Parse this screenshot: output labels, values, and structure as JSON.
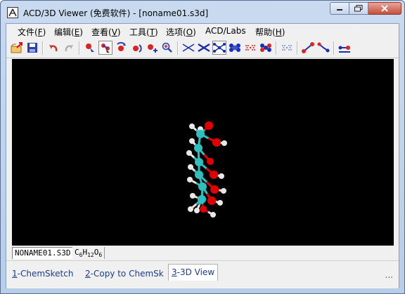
{
  "window": {
    "title": "ACD/3D Viewer (免费软件) - [noname01.s3d]"
  },
  "menu": {
    "items": [
      {
        "label": "文件(",
        "key": "F",
        "end": ")"
      },
      {
        "label": "编辑(",
        "key": "E",
        "end": ")"
      },
      {
        "label": "查看(",
        "key": "V",
        "end": ")"
      },
      {
        "label": "工具(",
        "key": "T",
        "end": ")"
      },
      {
        "label": "选项(",
        "key": "O",
        "end": ")"
      },
      {
        "label": "ACD/Labs",
        "key": "",
        "end": ""
      },
      {
        "label": "帮助(",
        "key": "H",
        "end": ")"
      }
    ]
  },
  "toolbar": {
    "buttons": [
      "open-icon",
      "save-icon",
      "undo-icon",
      "redo-icon",
      "select-atom-icon",
      "select-fragment-icon",
      "rotate-icon",
      "rotate-z-icon",
      "move-icon",
      "zoom-icon",
      "wireframe-icon",
      "sticks-icon",
      "ball-stick-icon",
      "spacefill-icon",
      "dots-icon",
      "disks-icon",
      "surface-icon",
      "measure-distance-icon",
      "measure-angle-icon",
      "display-options-icon"
    ],
    "pressed": "select-fragment-icon"
  },
  "tabs": {
    "file_tab": "NONAME01.S3D",
    "formula_c": "C",
    "formula_c_sub": "6",
    "formula_h": "H",
    "formula_h_sub": "12",
    "formula_o": "O",
    "formula_o_sub": "6"
  },
  "statusbar": {
    "item1_key": "1",
    "item1_label": "-ChemSketch",
    "item2_key": "2",
    "item2_label": "-Copy to ChemSk",
    "item3_key": "3",
    "item3_label": "-3D View",
    "ellipsis": "..."
  },
  "colors": {
    "carbon": "#2fbfbf",
    "oxygen": "#e00000",
    "hydrogen": "#e8e8e8",
    "viewport_bg": "#000000"
  }
}
